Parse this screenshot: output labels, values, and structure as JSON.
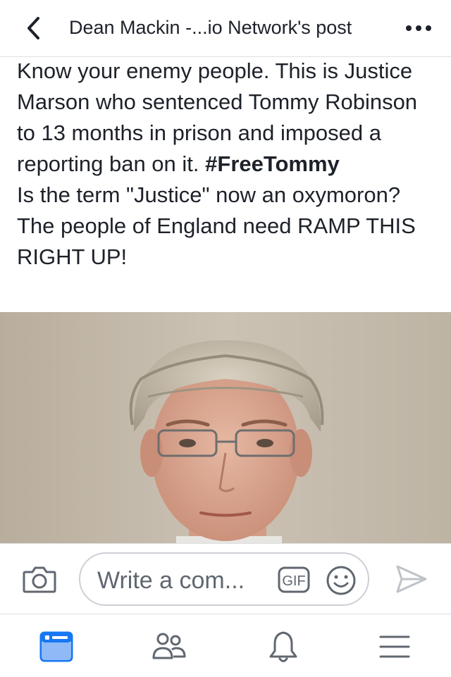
{
  "header": {
    "title": "Dean Mackin -...io Network's post",
    "back_icon": "chevron-left-icon",
    "more_icon": "more-horizontal-icon"
  },
  "post": {
    "line1": "Know your enemy people. This is Justice Marson who sentenced Tommy Robinson to 13 months in prison and imposed a reporting ban on it.",
    "hashtag": "#FreeTommy",
    "line2": "Is the term \"Justice\" now an oxymoron? The people of England need RAMP THIS RIGHT UP!"
  },
  "composer": {
    "placeholder": "Write a com...",
    "gif_label": "GIF",
    "camera_icon": "camera-icon",
    "emoji_icon": "emoji-icon",
    "send_icon": "send-icon"
  },
  "tabs": [
    {
      "icon": "news-feed-icon",
      "active": true
    },
    {
      "icon": "friends-icon"
    },
    {
      "icon": "notifications-bell-icon"
    },
    {
      "icon": "menu-icon"
    }
  ],
  "colors": {
    "accent": "#1877f2",
    "icon_gray": "#606770",
    "divider": "#dddfe2"
  }
}
